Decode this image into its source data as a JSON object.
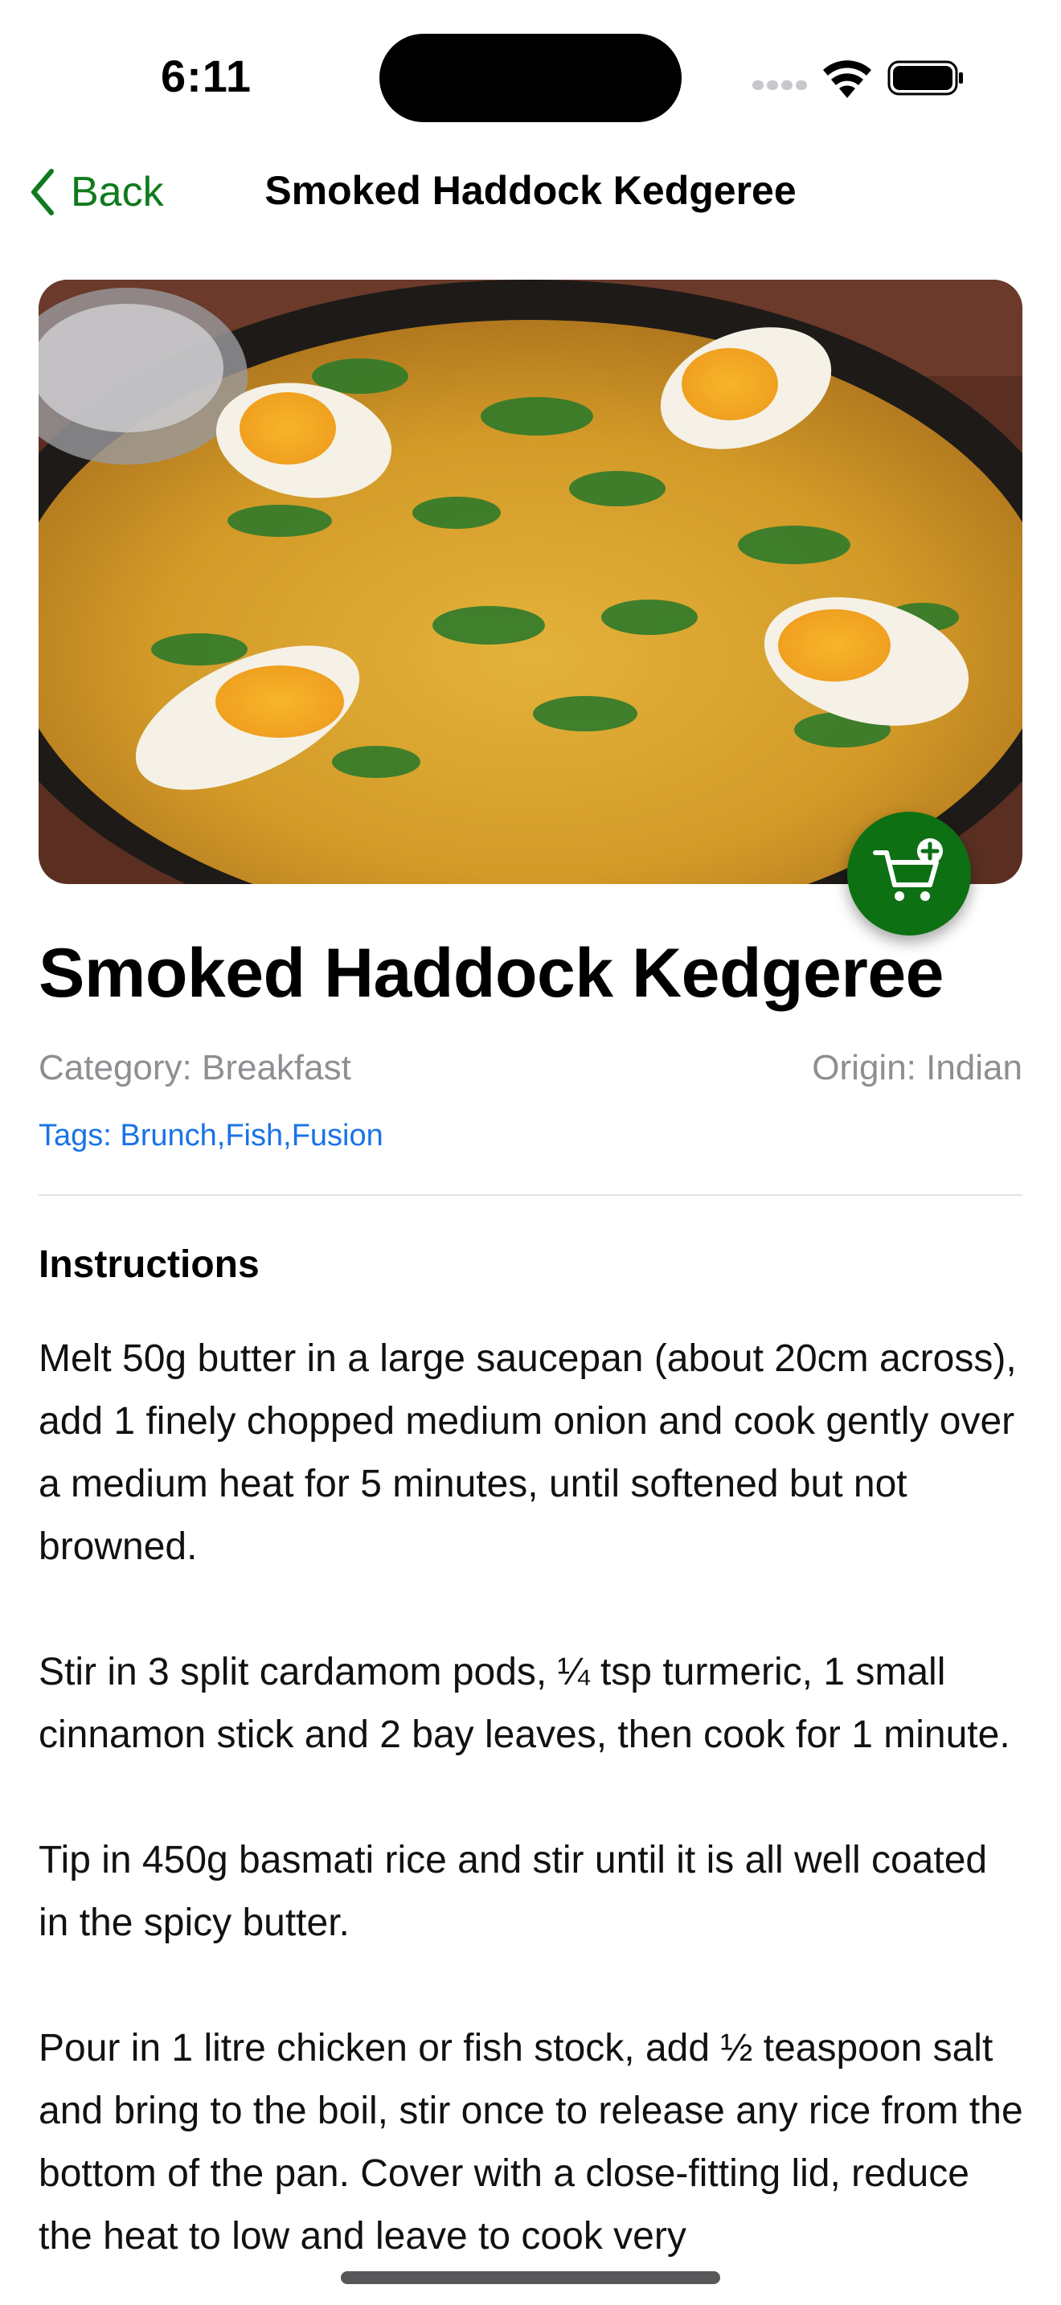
{
  "status_bar": {
    "time": "6:11"
  },
  "nav": {
    "back_label": "Back",
    "title": "Smoked Haddock Kedgeree"
  },
  "hero_image": {
    "icon": "meal-photo"
  },
  "fab": {
    "icon": "cart-plus-icon",
    "color": "#0d7012"
  },
  "meal": {
    "title": "Smoked Haddock Kedgeree",
    "category": "Category: Breakfast",
    "origin": "Origin: Indian",
    "tags": "Tags: Brunch,Fish,Fusion"
  },
  "instructions": {
    "heading": "Instructions",
    "paragraphs": [
      "Melt 50g butter in a large saucepan (about 20cm across), add 1 finely chopped medium onion and cook gently over a medium heat for 5 minutes, until softened but not browned.",
      "Stir in 3 split cardamom pods, ¼ tsp turmeric, 1 small cinnamon stick and 2 bay leaves, then cook for 1 minute.",
      "Tip in 450g basmati rice and stir until it is all well coated in the spicy butter.",
      "Pour in 1 litre chicken or fish stock, add ½ teaspoon salt and bring to the boil, stir once to release any rice from the bottom of the pan. Cover with a close-fitting lid, reduce the heat to low and leave to cook very"
    ]
  },
  "colors": {
    "accent": "#0f7a1e",
    "link": "#1a73e8",
    "secondary_text": "#8e8e93"
  }
}
